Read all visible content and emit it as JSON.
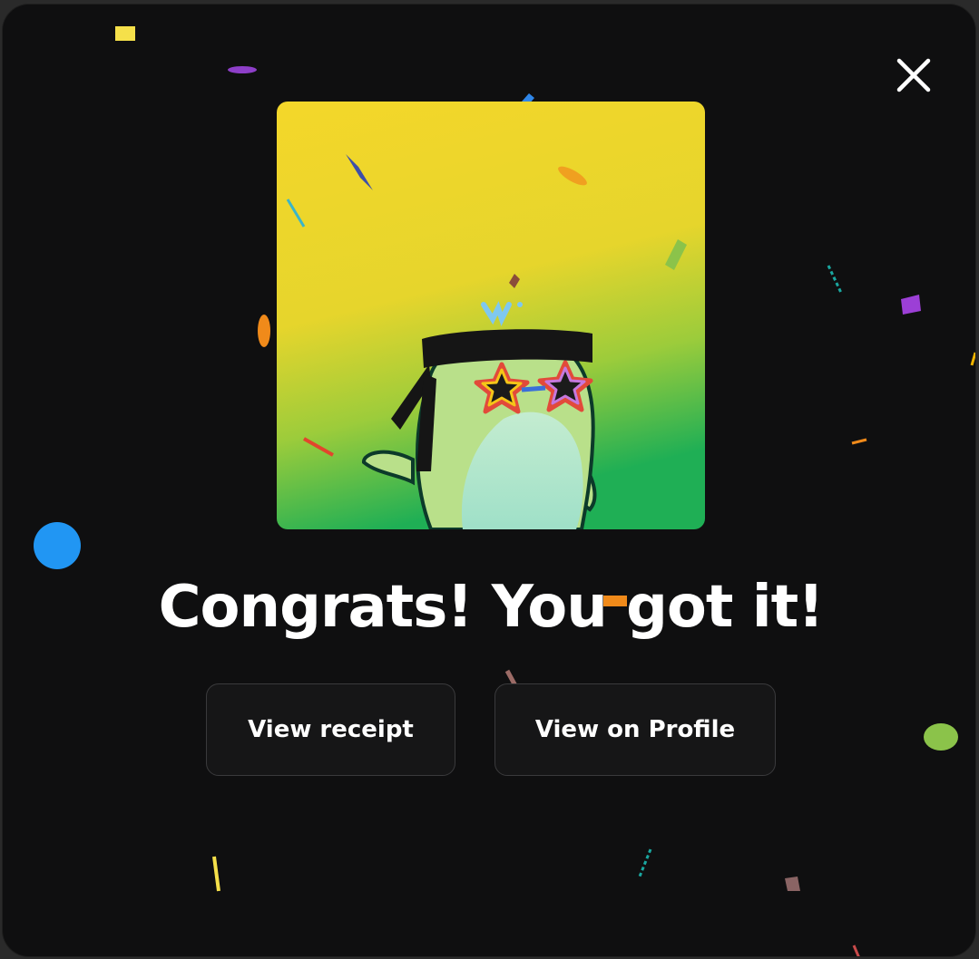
{
  "dialog": {
    "close_icon": "close-icon",
    "title": "Congrats! You got it!",
    "buttons": {
      "view_receipt": "View receipt",
      "view_on_profile": "View on Profile"
    },
    "artwork": {
      "background_top": "#f2d42b",
      "background_bottom": "#1fae55",
      "character_body": "#b9e08a",
      "headband": "#151515"
    }
  },
  "colors": {
    "modal_background": "#0f0f10",
    "button_background": "#161617",
    "button_border": "#3a3a3c",
    "text": "#ffffff"
  }
}
